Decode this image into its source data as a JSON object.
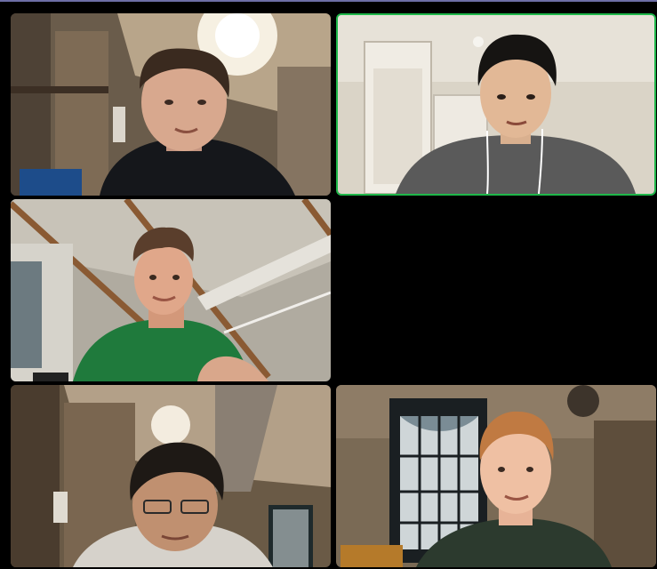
{
  "window": {
    "title": ""
  },
  "colors": {
    "background": "#000000",
    "active_speaker_border": "#1fb84a",
    "top_border": "#6d6ea6"
  },
  "gallery": {
    "tiles": [
      {
        "id": "tile-1",
        "name": "",
        "active": false
      },
      {
        "id": "tile-2",
        "name": "",
        "active": true
      },
      {
        "id": "tile-3",
        "name": "",
        "active": false
      },
      {
        "id": "tile-4",
        "name": "",
        "active": false
      },
      {
        "id": "tile-5",
        "name": "",
        "active": false
      }
    ]
  }
}
